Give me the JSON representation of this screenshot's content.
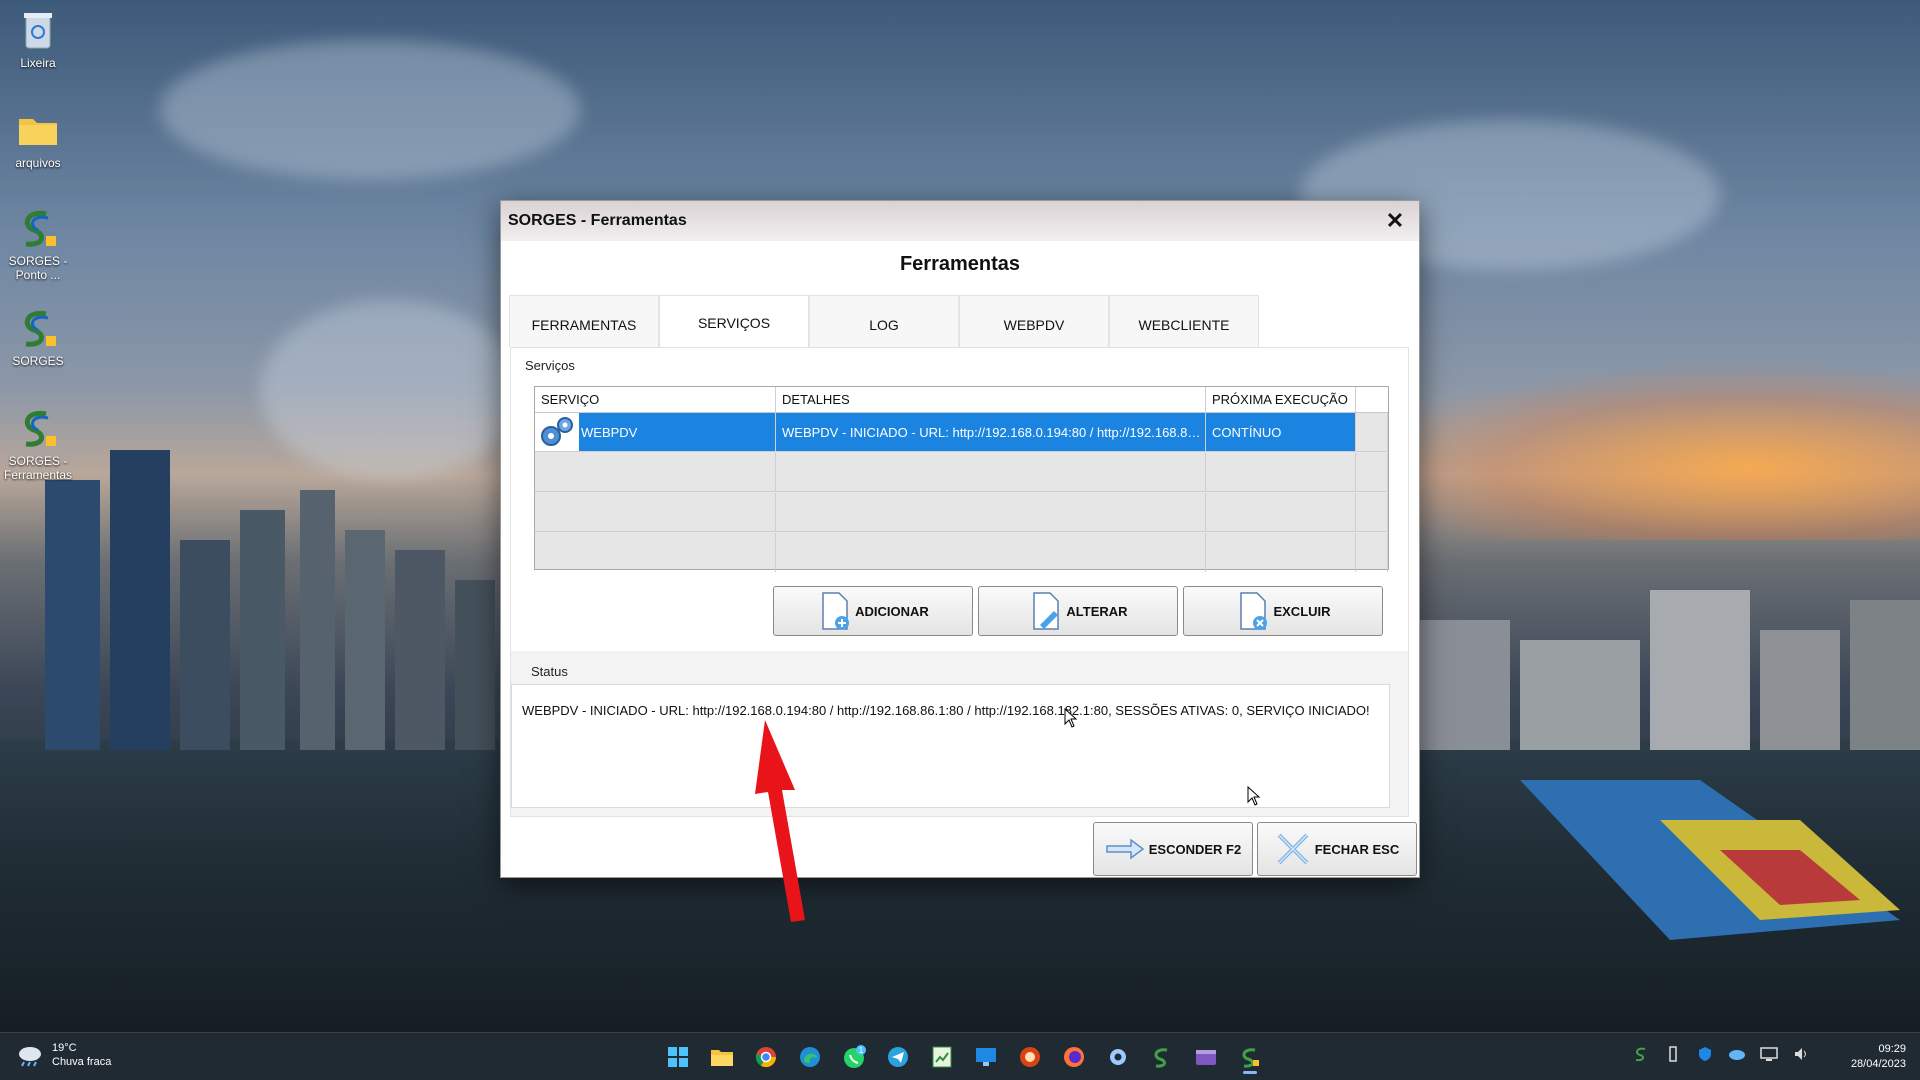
{
  "desktop": {
    "icons": [
      {
        "label": "Lixeira"
      },
      {
        "label": "arquivos"
      },
      {
        "label": "SORGES - Ponto ..."
      },
      {
        "label": "SORGES"
      },
      {
        "label": "SORGES - Ferramentas"
      }
    ]
  },
  "window": {
    "title": "SORGES - Ferramentas",
    "close_label": "✕",
    "heading": "Ferramentas",
    "tabs": [
      "FERRAMENTAS",
      "SERVIÇOS",
      "LOG",
      "WEBPDV",
      "WEBCLIENTE"
    ],
    "active_tab": "SERVIÇOS"
  },
  "services": {
    "group_label": "Serviços",
    "columns": [
      "SERVIÇO",
      "DETALHES",
      "PRÓXIMA EXECUÇÃO"
    ],
    "rows": [
      {
        "service": "WEBPDV",
        "details": "WEBPDV - INICIADO - URL: http://192.168.0.194:80 / http://192.168.86.1:80 / http://192.168.182.1:80",
        "next_run": "CONTÍNUO",
        "icon": "gears-icon",
        "selected": true
      }
    ],
    "buttons": {
      "add": "ADICIONAR",
      "edit": "ALTERAR",
      "delete": "EXCLUIR"
    }
  },
  "status": {
    "group_label": "Status",
    "text": "WEBPDV - INICIADO - URL: http://192.168.0.194:80 / http://192.168.86.1:80 / http://192.168.182.1:80, SESSÕES ATIVAS: 0, SERVIÇO INICIADO!"
  },
  "footer_buttons": {
    "hide": "ESCONDER F2",
    "close": "FECHAR ESC"
  },
  "taskbar": {
    "weather_temp": "19°C",
    "weather_desc": "Chuva fraca",
    "time": "09:29",
    "date": "28/04/2023",
    "apps": [
      "start-icon",
      "file-explorer-icon",
      "chrome-icon",
      "edge-icon",
      "whatsapp-icon",
      "telegram-icon",
      "spreadsheet-icon",
      "remote-desktop-icon",
      "app-red-icon",
      "firefox-icon",
      "settings-icon",
      "sorges-icon",
      "video-editor-icon",
      "sorges-ferramentas-icon"
    ],
    "whatsapp_badge": "1"
  },
  "colors": {
    "selection": "#1a84e0",
    "annotation_arrow": "#e8141a"
  }
}
